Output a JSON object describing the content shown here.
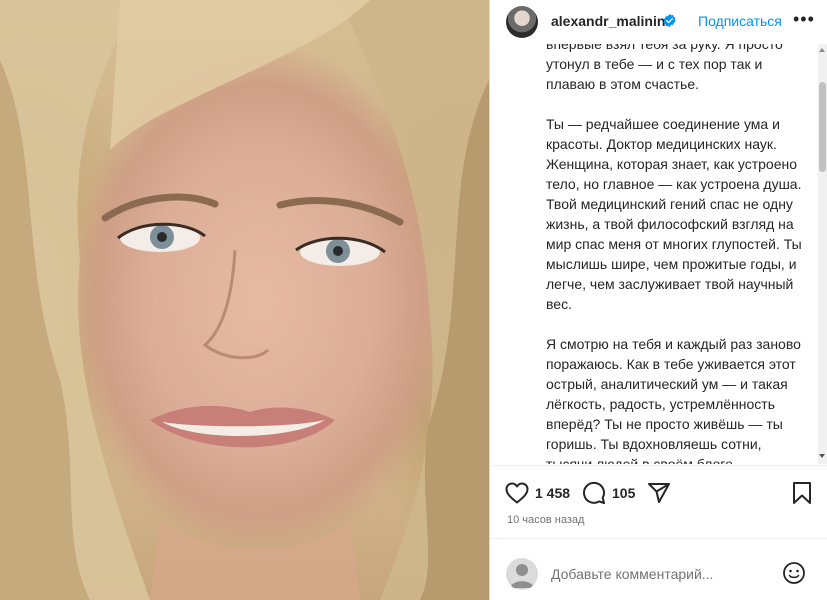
{
  "post": {
    "author": "alexandr_malinin",
    "follow_label": "Подписаться",
    "more_label": "•••",
    "caption_paragraphs": [
      "впервые взял тебя за руку. Я просто утонул в тебе — и с тех пор так и плаваю в этом счастье.",
      "Ты — редчайшее соединение ума и красоты. Доктор медицинских наук. Женщина, которая знает, как устроено тело, но главное — как устроена душа. Твой медицинский гений спас не одну жизнь, а твой философский взгляд на мир спас меня от многих глупостей. Ты мыслишь шире, чем прожитые годы, и легче, чем заслуживает твой научный вес.",
      "Я смотрю на тебя и каждый раз заново поражаюсь. Как в тебе уживается этот острый, аналитический ум — и такая лёгкость, радость, устремлённость вперёд? Ты не просто живёшь — ты горишь. Ты вдохновляешь сотни, тысячи людей в своём блоге «Взрослеть красиво». И"
    ],
    "likes": "1 458",
    "comments": "105",
    "time_ago": "10 часов назад"
  },
  "comment_box": {
    "placeholder": "Добавьте комментарий..."
  },
  "icons": {
    "like": "heart-icon",
    "comment": "comment-icon",
    "share": "share-icon",
    "save": "bookmark-icon",
    "emoji": "emoji-icon",
    "verified": "verified-badge-icon"
  },
  "colors": {
    "link": "#0095f6",
    "text": "#262626",
    "muted": "#737373",
    "verified": "#0095f6"
  }
}
